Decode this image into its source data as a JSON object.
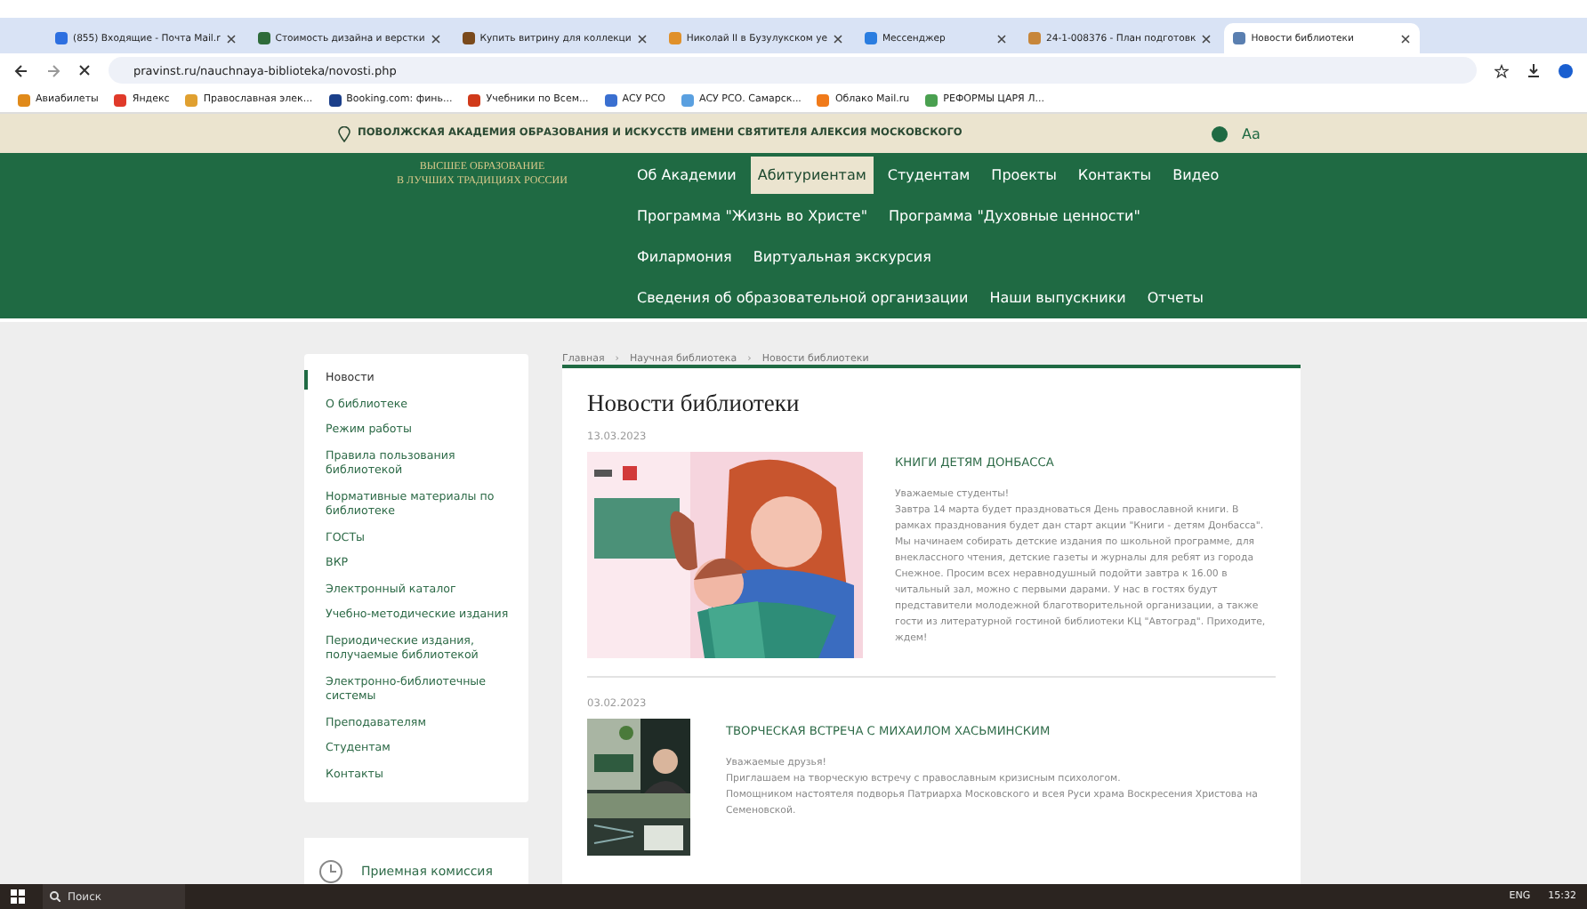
{
  "browser": {
    "tabs": [
      {
        "title": "(855) Входящие - Почта Mail.r",
        "selected": false,
        "color": "#2d6fe0"
      },
      {
        "title": "Стоимость дизайна и верстки",
        "selected": false,
        "color": "#2e6b3a"
      },
      {
        "title": "Купить витрину для коллекци",
        "selected": false,
        "color": "#7a4a1c"
      },
      {
        "title": "Николай II в Бузулукском уе",
        "selected": false,
        "color": "#e0902a"
      },
      {
        "title": "Мессенджер",
        "selected": false,
        "color": "#2a7de0"
      },
      {
        "title": "24-1-008376 - План подготовк",
        "selected": false,
        "color": "#c7863a"
      },
      {
        "title": "Новости библиотеки",
        "selected": true,
        "color": "#5a7fb0"
      }
    ],
    "url": "pravinst.ru/nauchnaya-biblioteka/novosti.php",
    "bookmarks": [
      {
        "label": "Авиабилеты",
        "color": "#e08a1a"
      },
      {
        "label": "Яндекс",
        "color": "#e03a2a"
      },
      {
        "label": "Православная элек...",
        "color": "#e0a030"
      },
      {
        "label": "Booking.com: финь...",
        "color": "#1b3f8a"
      },
      {
        "label": "Учебники по Всем...",
        "color": "#d03a1a"
      },
      {
        "label": "АСУ РСО",
        "color": "#3a6fd0"
      },
      {
        "label": "АСУ РСО. Самарск...",
        "color": "#5aa0e0"
      },
      {
        "label": "Облако Mail.ru",
        "color": "#f07a1a"
      },
      {
        "label": "РЕФОРМЫ ЦАРЯ Л...",
        "color": "#4aa050"
      }
    ]
  },
  "site": {
    "top_title": "ПОВОЛЖСКАЯ АКАДЕМИЯ ОБРАЗОВАНИЯ И ИСКУССТВ ИМЕНИ СВЯТИТЕЛЯ АЛЕКСИЯ МОСКОВСКОГО",
    "font_switch": "Aa",
    "slogan": [
      "ВЫСШЕЕ ОБРАЗОВАНИЕ",
      "В ЛУЧШИХ ТРАДИЦИЯХ РОССИИ"
    ],
    "nav_rows": [
      [
        {
          "label": "Об Академии",
          "selected": false
        },
        {
          "label": "Абитуриентам",
          "selected": true
        },
        {
          "label": "Студентам",
          "selected": false
        },
        {
          "label": "Проекты",
          "selected": false
        },
        {
          "label": "Контакты",
          "selected": false
        },
        {
          "label": "Видео",
          "selected": false
        }
      ],
      [
        {
          "label": "Программа \"Жизнь во Христе\"",
          "selected": false
        },
        {
          "label": "Программа \"Духовные ценности\"",
          "selected": false
        }
      ],
      [
        {
          "label": "Филармония",
          "selected": false
        },
        {
          "label": "Виртуальная экскурсия",
          "selected": false
        }
      ],
      [
        {
          "label": "Сведения об образовательной организации",
          "selected": false
        },
        {
          "label": "Наши выпускники",
          "selected": false
        },
        {
          "label": "Отчеты",
          "selected": false
        }
      ]
    ]
  },
  "sidebar": {
    "items": [
      {
        "label": "Новости",
        "selected": true
      },
      {
        "label": "О библиотеке",
        "selected": false
      },
      {
        "label": "Режим работы",
        "selected": false
      },
      {
        "label": "Правила пользования библиотекой",
        "selected": false
      },
      {
        "label": "Нормативные материалы по библиотеке",
        "selected": false
      },
      {
        "label": "ГОСТы",
        "selected": false
      },
      {
        "label": "ВКР",
        "selected": false
      },
      {
        "label": "Электронный каталог",
        "selected": false
      },
      {
        "label": "Учебно-методические издания",
        "selected": false
      },
      {
        "label": "Периодические издания, получаемые библиотекой",
        "selected": false
      },
      {
        "label": "Электронно-библиотечные системы",
        "selected": false
      },
      {
        "label": "Преподавателям",
        "selected": false
      },
      {
        "label": "Студентам",
        "selected": false
      },
      {
        "label": "Контакты",
        "selected": false
      }
    ],
    "admission": "Приемная комиссия"
  },
  "breadcrumbs": [
    "Главная",
    "Научная библиотека",
    "Новости библиотеки"
  ],
  "breadcrumb_separator": "›",
  "page_title": "Новости библиотеки",
  "news": [
    {
      "date": "13.03.2023",
      "title": "КНИГИ ДЕТЯМ ДОНБАССА",
      "kind": "wide",
      "paragraphs": [
        "Уважаемые студенты!",
        "Завтра 14 марта будет праздноваться День православной книги. В рамках празднования будет дан старт акции \"Книги - детям Донбасса\". Мы начинаем собирать детские издания по школьной программе, для внеклассного чтения, детские газеты и журналы для ребят из города Снежное. Просим всех неравнодушный подойти завтра к 16.00 в читальный зал, можно с первыми дарами. У нас в гостях будут представители молодежной благотворительной организации, а также гости из литературной гостиной библиотеки КЦ \"Автоград\". Приходите, ждем!"
      ]
    },
    {
      "date": "03.02.2023",
      "title": "ТВОРЧЕСКАЯ ВСТРЕЧА С МИХАИЛОМ ХАСЬМИНСКИМ",
      "kind": "poster",
      "paragraphs": [
        "Уважаемые друзья!",
        "Приглашаем на творческую встречу с православным кризисным психологом.",
        "Помощником настоятеля подворья Патриарха Московского и всея Руси храма Воскресения Христова на Семеновской."
      ]
    }
  ],
  "taskbar": {
    "search": "Поиск",
    "language": "ENG",
    "time": "15:32"
  }
}
